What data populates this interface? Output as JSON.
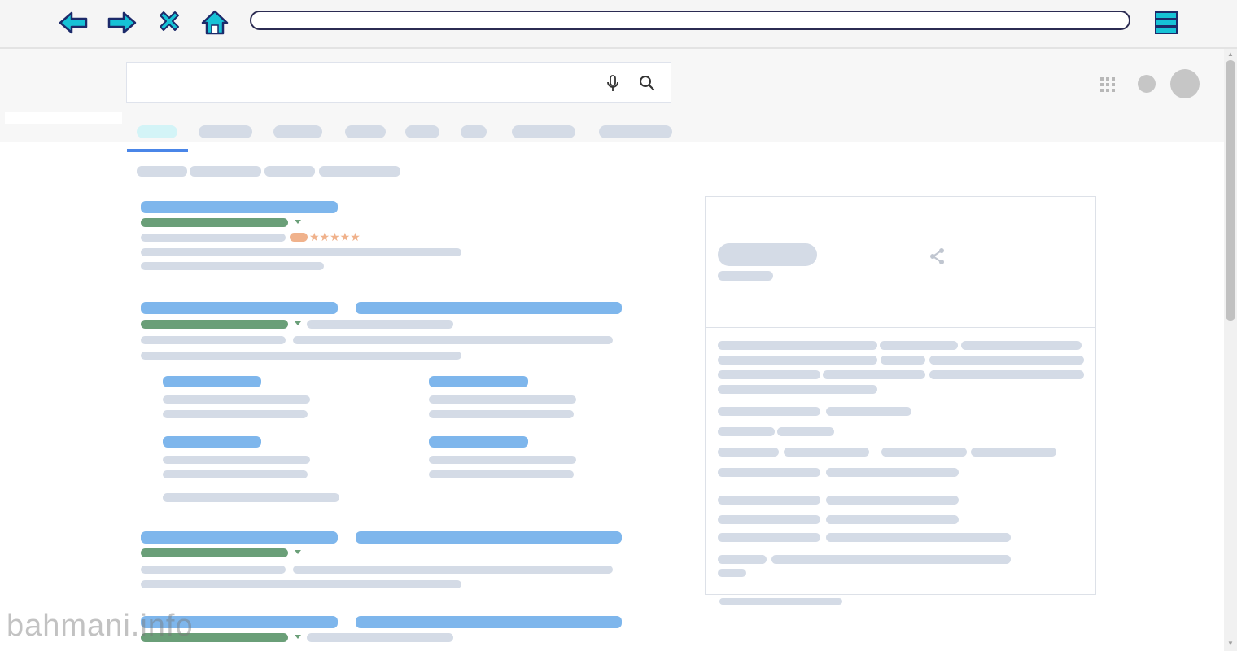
{
  "browser": {
    "address_value": "",
    "icons": [
      "back-arrow-icon",
      "forward-arrow-icon",
      "close-x-icon",
      "home-icon",
      "menu-stack-icon"
    ],
    "accent_color": "#16c2d6",
    "outline_color": "#1c2a6a"
  },
  "search": {
    "query_value": "",
    "placeholder": "",
    "icons": [
      "microphone-icon",
      "search-icon"
    ]
  },
  "header_icons": [
    "apps-grid-icon",
    "notification-dot-icon",
    "avatar"
  ],
  "knowledge_panel": {
    "icons": [
      "share-icon"
    ]
  },
  "colors": {
    "link": "#7eb6ec",
    "url": "#6a9f78",
    "text_placeholder": "#d4dbe6",
    "rating": "#f0b28c",
    "active_tab": "#1a73e8"
  },
  "watermark": "bahmani.info"
}
